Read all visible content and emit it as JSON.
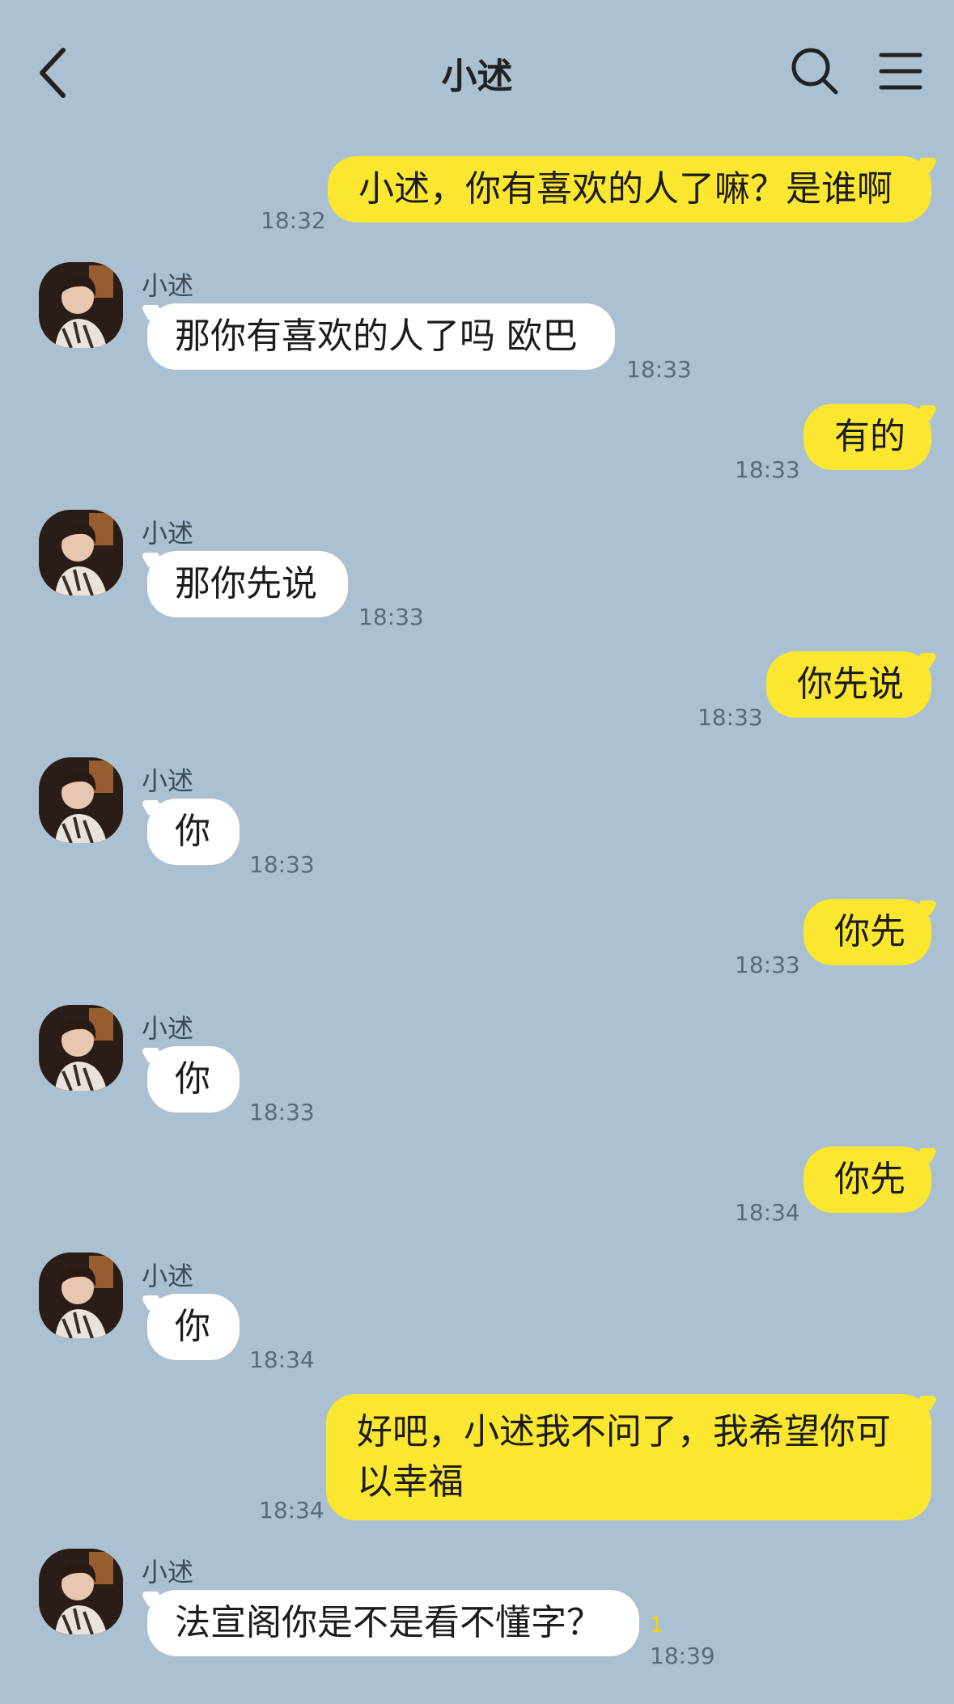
{
  "header": {
    "title": "小述",
    "back_icon": "chevron-left-icon",
    "search_icon": "search-icon",
    "menu_icon": "menu-icon"
  },
  "colors": {
    "background": "#abc1d1",
    "outgoing_bubble": "#fbe630",
    "incoming_bubble": "#ffffff",
    "unread_count": "#f2d500"
  },
  "messages": [
    {
      "direction": "out",
      "text": "小述，你有喜欢的人了嘛？是谁啊",
      "time": "18:32"
    },
    {
      "direction": "in",
      "sender": "小述",
      "text": "那你有喜欢的人了吗 欧巴",
      "time": "18:33"
    },
    {
      "direction": "out",
      "text": "有的",
      "time": "18:33"
    },
    {
      "direction": "in",
      "sender": "小述",
      "text": "那你先说",
      "time": "18:33"
    },
    {
      "direction": "out",
      "text": "你先说",
      "time": "18:33"
    },
    {
      "direction": "in",
      "sender": "小述",
      "text": "你",
      "time": "18:33"
    },
    {
      "direction": "out",
      "text": "你先",
      "time": "18:33"
    },
    {
      "direction": "in",
      "sender": "小述",
      "text": "你",
      "time": "18:33"
    },
    {
      "direction": "out",
      "text": "你先",
      "time": "18:34"
    },
    {
      "direction": "in",
      "sender": "小述",
      "text": "你",
      "time": "18:34"
    },
    {
      "direction": "out",
      "text": "好吧，小述我不问了，我希望你可以幸福",
      "time": "18:34"
    },
    {
      "direction": "in",
      "sender": "小述",
      "text": "法宣阁你是不是看不懂字？",
      "time": "18:39",
      "unread": "1"
    }
  ]
}
